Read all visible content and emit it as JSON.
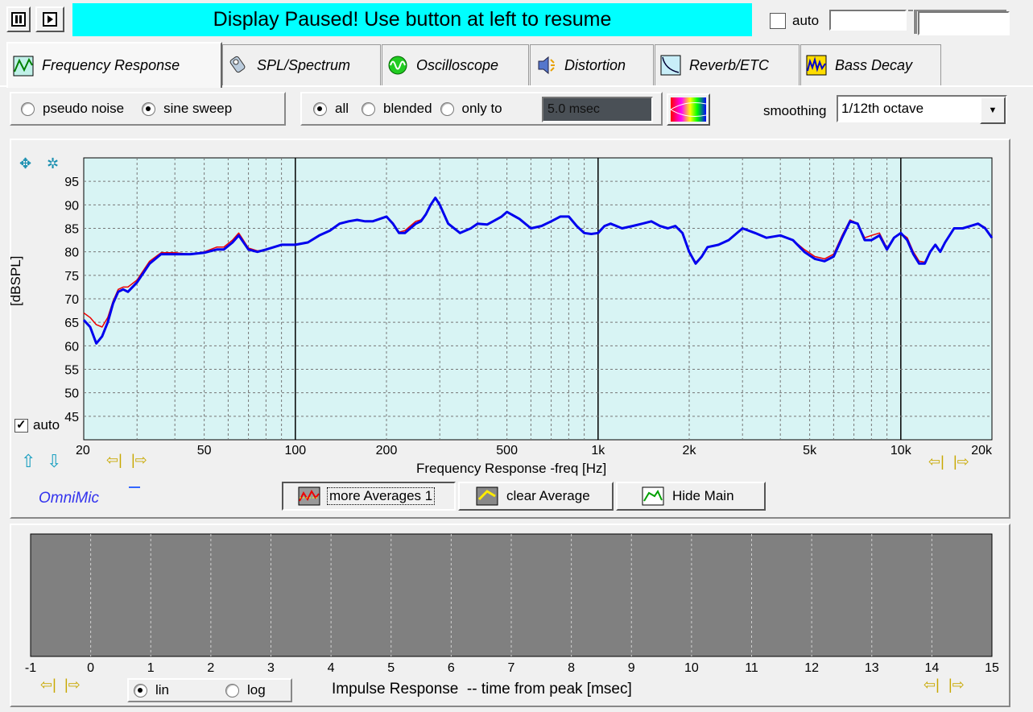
{
  "toolbar": {
    "pause_icon": "pause-icon",
    "play_icon": "play-icon",
    "banner": "Display Paused! Use button at left to resume",
    "banner_color": "#00ffff",
    "auto_label": "auto",
    "auto_checked": false
  },
  "tabs": [
    {
      "label": "Frequency Response",
      "icon": "frequency-response-icon",
      "active": true
    },
    {
      "label": "SPL/Spectrum",
      "icon": "spl-meter-icon",
      "active": false
    },
    {
      "label": "Oscilloscope",
      "icon": "oscilloscope-icon",
      "active": false
    },
    {
      "label": "Distortion",
      "icon": "distortion-icon",
      "active": false
    },
    {
      "label": "Reverb/ETC",
      "icon": "reverb-icon",
      "active": false
    },
    {
      "label": "Bass Decay",
      "icon": "bass-decay-icon",
      "active": false
    }
  ],
  "options": {
    "signal": {
      "pseudo_noise": "pseudo noise",
      "sine_sweep": "sine sweep",
      "selected": "sine sweep"
    },
    "window": {
      "all": "all",
      "blended": "blended",
      "only_to": "only to",
      "selected": "all",
      "time_value": "5.0 msec"
    },
    "smoothing_label": "smoothing",
    "smoothing_value": "1/12th octave"
  },
  "freq_panel": {
    "ylabel": "[dBSPL]",
    "xlabel": "Frequency Response -freq [Hz]",
    "auto_label": "auto",
    "auto_checked": true,
    "brand": "OmniMic",
    "brand_color": "#3333ee",
    "buttons": {
      "more_averages": "more Averages 1",
      "clear_average": "clear Average",
      "hide_main": "Hide Main"
    },
    "plot_bg": "#d8f4f4"
  },
  "chart_data": [
    {
      "type": "line",
      "xscale": "log",
      "xlim": [
        20,
        20000
      ],
      "ylim": [
        40,
        100
      ],
      "x_ticks": [
        20,
        50,
        100,
        200,
        500,
        1000,
        2000,
        5000,
        10000,
        20000
      ],
      "x_tick_labels": [
        "20",
        "50",
        "100",
        "200",
        "500",
        "1k",
        "2k",
        "5k",
        "10k",
        "20k"
      ],
      "y_ticks": [
        45,
        50,
        55,
        60,
        65,
        70,
        75,
        80,
        85,
        90,
        95
      ],
      "y_tick_labels": [
        "45",
        "50",
        "55",
        "60",
        "65",
        "70",
        "75",
        "80",
        "85",
        "90",
        "95"
      ],
      "xlabel": "Frequency Response -freq [Hz]",
      "ylabel": "[dBSPL]",
      "grid": true,
      "series": [
        {
          "color": "#0000ee",
          "x": [
            20,
            21,
            22,
            23,
            24,
            25,
            26,
            27,
            28,
            30,
            33,
            36,
            40,
            45,
            50,
            55,
            58,
            62,
            65,
            70,
            75,
            80,
            90,
            100,
            110,
            120,
            130,
            140,
            150,
            160,
            170,
            180,
            190,
            200,
            210,
            220,
            230,
            250,
            260,
            270,
            280,
            290,
            300,
            320,
            350,
            380,
            400,
            430,
            450,
            480,
            500,
            550,
            600,
            650,
            700,
            750,
            800,
            850,
            900,
            950,
            1000,
            1050,
            1100,
            1200,
            1300,
            1400,
            1500,
            1600,
            1700,
            1800,
            1900,
            2000,
            2100,
            2200,
            2300,
            2500,
            2700,
            3000,
            3300,
            3600,
            4000,
            4400,
            4800,
            5200,
            5600,
            6000,
            6400,
            6800,
            7200,
            7600,
            8000,
            8500,
            9000,
            9500,
            10000,
            10500,
            11000,
            11500,
            12000,
            12500,
            13000,
            13500,
            14000,
            15000,
            16000,
            17000,
            18000,
            19000,
            20000
          ],
          "y": [
            65.5,
            64,
            60.5,
            62,
            65,
            69,
            71.5,
            72,
            71.5,
            73.5,
            77.5,
            79.5,
            79.5,
            79.5,
            79.8,
            80.5,
            80.5,
            82,
            83.5,
            80.5,
            80,
            80.5,
            81.5,
            81.5,
            82,
            83.5,
            84.5,
            86,
            86.5,
            86.8,
            86.5,
            86.5,
            87,
            87.5,
            86,
            84,
            84,
            86,
            86.5,
            88,
            90,
            91.5,
            90,
            86,
            84,
            85,
            86,
            85.8,
            86.5,
            87.5,
            88.5,
            87,
            85,
            85.5,
            86.5,
            87.5,
            87.5,
            85.5,
            84,
            83.8,
            84,
            85.5,
            86,
            85,
            85.5,
            86,
            86.5,
            85.5,
            85,
            85.5,
            84,
            80,
            77.5,
            79,
            81,
            81.5,
            82.5,
            85,
            84,
            83,
            83.5,
            82.5,
            80,
            78.5,
            78,
            79,
            83,
            86.5,
            86,
            82.5,
            82.5,
            83.5,
            80.5,
            83,
            84,
            82.5,
            79.5,
            77.5,
            77.5,
            80,
            81.5,
            80,
            82,
            85,
            85,
            85.5,
            86,
            85,
            83
          ]
        },
        {
          "color": "#ee0000",
          "x": [
            20,
            21,
            22,
            23,
            24,
            25,
            26,
            27,
            28,
            30,
            33,
            36,
            40,
            45,
            50,
            55,
            58,
            62,
            65,
            70,
            75,
            80,
            90,
            100,
            110,
            120,
            130,
            140,
            150,
            160,
            170,
            180,
            190,
            200,
            210,
            220,
            230,
            250,
            260,
            270,
            280,
            290,
            300,
            320,
            350,
            380,
            400,
            430,
            450,
            480,
            500,
            550,
            600,
            650,
            700,
            750,
            800,
            850,
            900,
            950,
            1000,
            1050,
            1100,
            1200,
            1300,
            1400,
            1500,
            1600,
            1700,
            1800,
            1900,
            2000,
            2100,
            2200,
            2300,
            2500,
            2700,
            3000,
            3300,
            3600,
            4000,
            4400,
            4800,
            5200,
            5600,
            6000,
            6400,
            6800,
            7200,
            7600,
            8000,
            8500,
            9000,
            9500,
            10000,
            10500,
            11000,
            11500,
            12000,
            12500,
            13000,
            13500,
            14000,
            15000,
            16000,
            17000,
            18000,
            19000,
            20000
          ],
          "y": [
            67,
            66,
            64.5,
            64,
            66,
            69.5,
            72,
            72.5,
            72.5,
            74,
            78,
            79.8,
            79.8,
            79.5,
            80,
            81,
            81,
            82.5,
            84,
            80.8,
            80.2,
            80.5,
            81.5,
            81.5,
            82,
            83.5,
            84.5,
            86,
            86.5,
            86.8,
            86.5,
            86.5,
            87,
            87.5,
            86.2,
            84.2,
            84.5,
            86.5,
            86.8,
            88,
            90,
            91.5,
            90,
            86,
            84,
            85,
            86,
            85.8,
            86.5,
            87.5,
            88.5,
            87,
            85,
            85.5,
            86.5,
            87.5,
            87.5,
            85.5,
            84,
            83.8,
            84,
            85.5,
            86,
            85,
            85.5,
            86,
            86.5,
            85.5,
            85,
            85.5,
            84,
            80,
            77.8,
            79,
            81,
            81.5,
            82.5,
            85,
            84,
            83,
            83.5,
            82.5,
            80.5,
            79,
            78.5,
            79.5,
            83.5,
            86.8,
            86,
            83,
            83.5,
            84,
            80.8,
            83,
            84,
            83,
            80,
            78,
            77.8,
            80,
            81.5,
            80,
            82,
            85,
            85,
            85.5,
            86,
            85.2,
            83
          ]
        }
      ]
    },
    {
      "type": "line",
      "xlim": [
        -1,
        15
      ],
      "x_ticks": [
        -1,
        0,
        1,
        2,
        3,
        4,
        5,
        6,
        7,
        8,
        9,
        10,
        11,
        12,
        13,
        14,
        15
      ],
      "x_tick_labels": [
        "-1",
        "0",
        "1",
        "2",
        "3",
        "4",
        "5",
        "6",
        "7",
        "8",
        "9",
        "10",
        "11",
        "12",
        "13",
        "14",
        "15"
      ],
      "xlabel": "Impulse Response  -- time from peak [msec]",
      "grid": true,
      "series": []
    }
  ],
  "impulse_panel": {
    "xlabel": "Impulse Response  -- time from peak [msec]",
    "lin_label": "lin",
    "log_label": "log",
    "selected": "lin",
    "plot_bg": "#808080"
  }
}
